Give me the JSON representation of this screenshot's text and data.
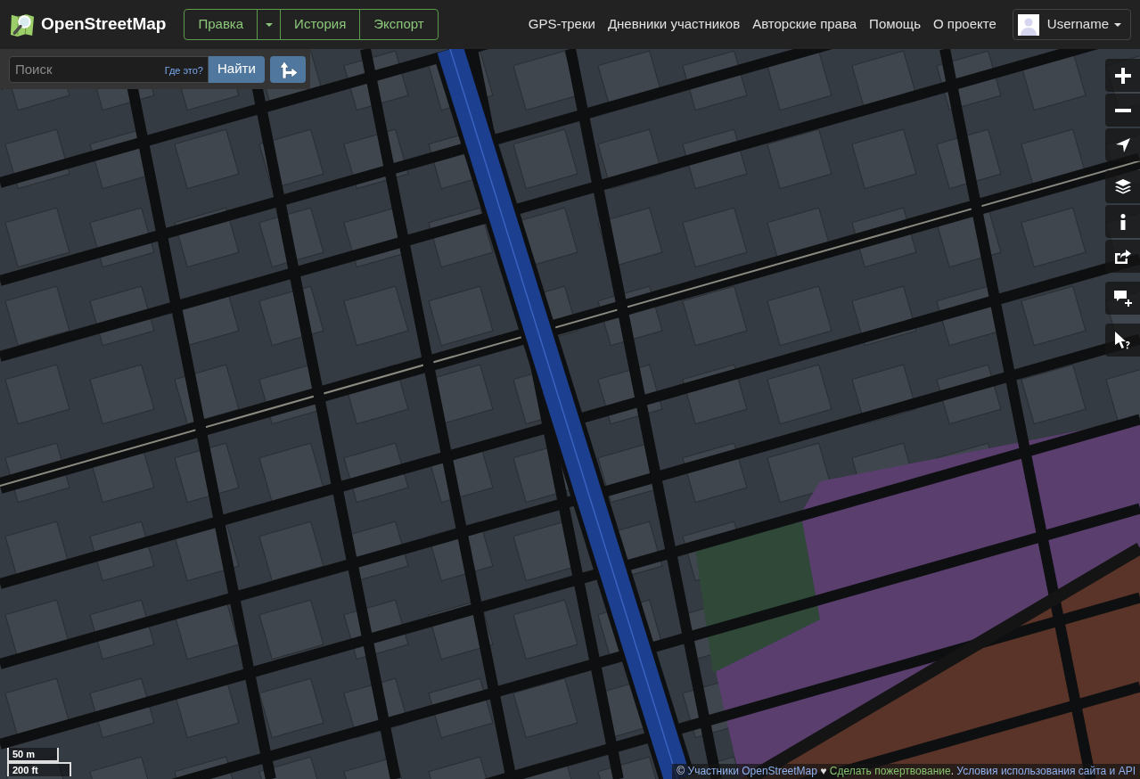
{
  "header": {
    "logo": {
      "text": "OpenStreetMap"
    },
    "edit_menu": [
      {
        "kind": "button",
        "label": "Правка"
      },
      {
        "kind": "dropdown"
      },
      {
        "kind": "button",
        "label": "История"
      },
      {
        "kind": "button",
        "label": "Экспорт"
      }
    ],
    "nav": [
      "GPS-треки",
      "Дневники участников",
      "Авторские права",
      "Помощь",
      "О проекте"
    ],
    "user": {
      "name": "Username"
    }
  },
  "search": {
    "placeholder": "Поиск",
    "where_link": "Где это?",
    "submit": "Найти"
  },
  "scale": {
    "metric": "50 m",
    "imperial": "200 ft"
  },
  "attribution": {
    "prefix": "©",
    "contributors_link": "Участники OpenStreetMap",
    "heart": "♥",
    "donate_link": "Сделать пожертвование",
    "separator": ".",
    "terms_link": "Условия использования сайта и API"
  }
}
